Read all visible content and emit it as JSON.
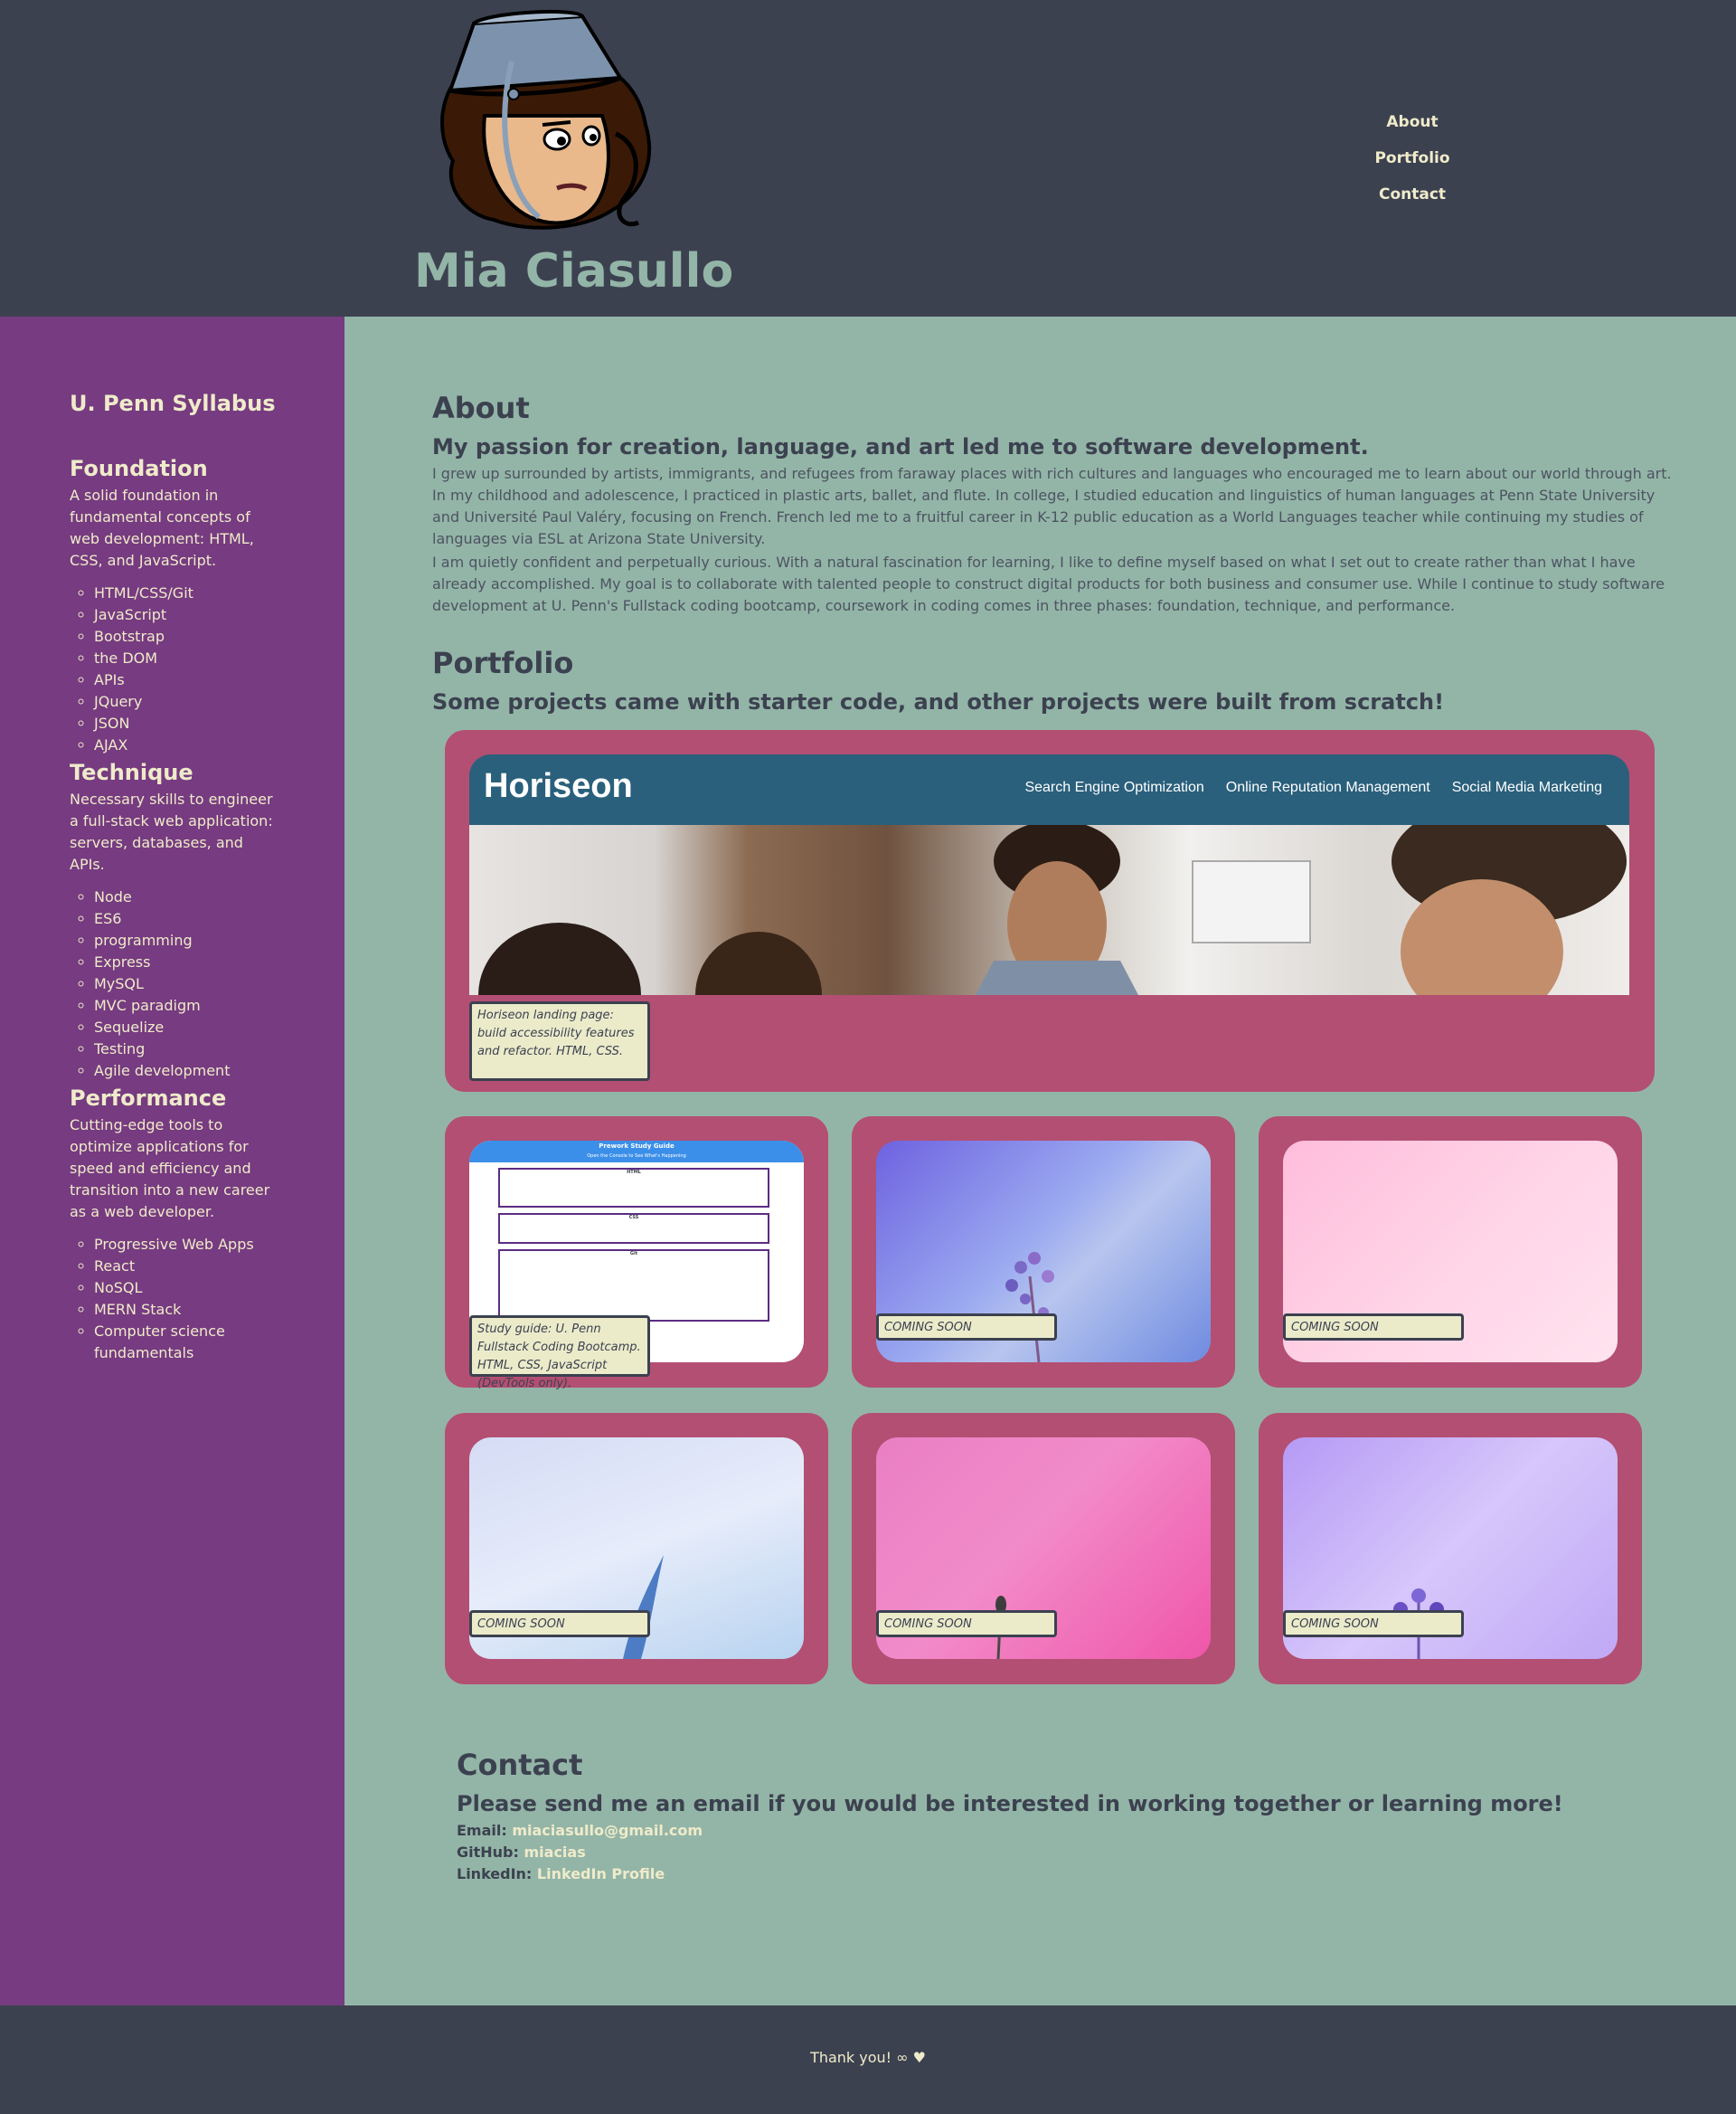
{
  "header": {
    "name": "Mia Ciasullo",
    "nav": [
      "About",
      "Portfolio",
      "Contact"
    ]
  },
  "sidebar": {
    "title": "U. Penn Syllabus",
    "sections": [
      {
        "heading": "Foundation",
        "description": "A solid foundation in fundamental concepts of web development: HTML, CSS, and JavaScript.",
        "items": [
          "HTML/CSS/Git",
          "JavaScript",
          "Bootstrap",
          "the DOM",
          "APIs",
          "JQuery",
          "JSON",
          "AJAX"
        ]
      },
      {
        "heading": "Technique",
        "description": "Necessary skills to engineer a full-stack web application: servers, databases, and APIs.",
        "items": [
          "Node",
          "ES6",
          "programming",
          "Express",
          "MySQL",
          "MVC paradigm",
          "Sequelize",
          "Testing",
          "Agile development"
        ]
      },
      {
        "heading": "Performance",
        "description": "Cutting-edge tools to optimize applications for speed and efficiency and transition into a new career as a web developer.",
        "items": [
          "Progressive Web Apps",
          "React",
          "NoSQL",
          "MERN Stack",
          "Computer science fundamentals"
        ]
      }
    ]
  },
  "about": {
    "heading": "About",
    "subheading": "My passion for creation, language, and art led me to software development.",
    "paragraphs": [
      "I grew up surrounded by artists, immigrants, and refugees from faraway places with rich cultures and languages who encouraged me to learn about our world through art. In my childhood and adolescence, I practiced in plastic arts, ballet, and flute. In college, I studied education and linguistics of human languages at Penn State University and Université Paul Valéry, focusing on French. French led me to a fruitful career in K-12 public education as a World Languages teacher while continuing my studies of languages via ESL at Arizona State University.",
      "I am quietly confident and perpetually curious. With a natural fascination for learning, I like to define myself based on what I set out to create rather than what I have already accomplished. My goal is to collaborate with talented people to construct digital products for both business and consumer use. While I continue to study software development at U. Penn's Fullstack coding bootcamp, coursework in coding comes in three phases: foundation, technique, and performance."
    ]
  },
  "portfolio": {
    "heading": "Portfolio",
    "subheading": "Some projects came with starter code, and other projects were built from scratch!",
    "featured": {
      "logo": "Horiseon",
      "nav": [
        "Search Engine Optimization",
        "Online Reputation Management",
        "Social Media Marketing"
      ],
      "caption": "Horiseon landing page: build accessibility features and refactor. HTML, CSS."
    },
    "projects": [
      {
        "caption": "Study guide: U. Penn Fullstack Coding Bootcamp. HTML, CSS, JavaScript (DevTools only).",
        "screen_title": "Prework Study Guide",
        "screen_sub": "Open the Console to See What's Happening",
        "screen_boxes": [
          "HTML",
          "CSS",
          "Git"
        ]
      },
      {
        "caption": "COMING SOON"
      },
      {
        "caption": "COMING SOON"
      },
      {
        "caption": "COMING SOON"
      },
      {
        "caption": "COMING SOON"
      },
      {
        "caption": "COMING SOON"
      }
    ]
  },
  "contact": {
    "heading": "Contact",
    "subheading": "Please send me an email if you would be interested in working together or learning more!",
    "email_label": "Email:",
    "email": "miaciasullo@gmail.com",
    "github_label": "GitHub:",
    "github": "miacias",
    "linkedin_label": "LinkedIn:",
    "linkedin": "LinkedIn Profile"
  },
  "footer": {
    "text": "Thank you! ∞ ♥"
  },
  "colors": {
    "header_bg": "#3c4150",
    "sidebar_bg": "#763b80",
    "main_bg": "#93b5a7",
    "card_bg": "#b34f72",
    "accent_text": "#efebca"
  }
}
